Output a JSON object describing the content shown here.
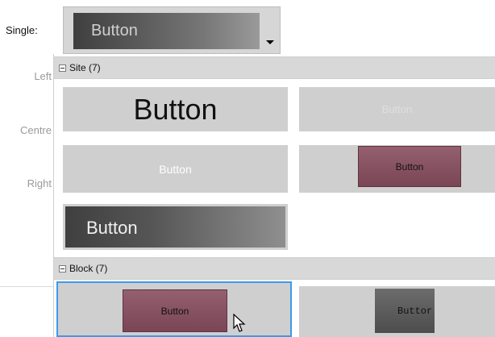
{
  "sidebar": {
    "single_label": "Single:",
    "left_label": "Left",
    "centre_label": "Centre",
    "right_label": "Right"
  },
  "single_dropdown": {
    "value": "Button",
    "icon": "chevron-down-icon"
  },
  "groups": [
    {
      "header": "Site (7)",
      "icon": "collapse-box-icon",
      "items": [
        {
          "label": "Button"
        },
        {
          "label": "Button"
        },
        {
          "label": "Button"
        },
        {
          "label": "Button"
        },
        {
          "label": "Button"
        }
      ]
    },
    {
      "header": "Block (7)",
      "icon": "collapse-box-icon",
      "items": [
        {
          "label": "Button"
        },
        {
          "label": "Buttor"
        }
      ]
    }
  ],
  "colors": {
    "selection_border": "#3d9be9",
    "tile_bg": "#cfcfcf",
    "header_bg": "#d8d8d8",
    "pink_button": "#86505f"
  }
}
